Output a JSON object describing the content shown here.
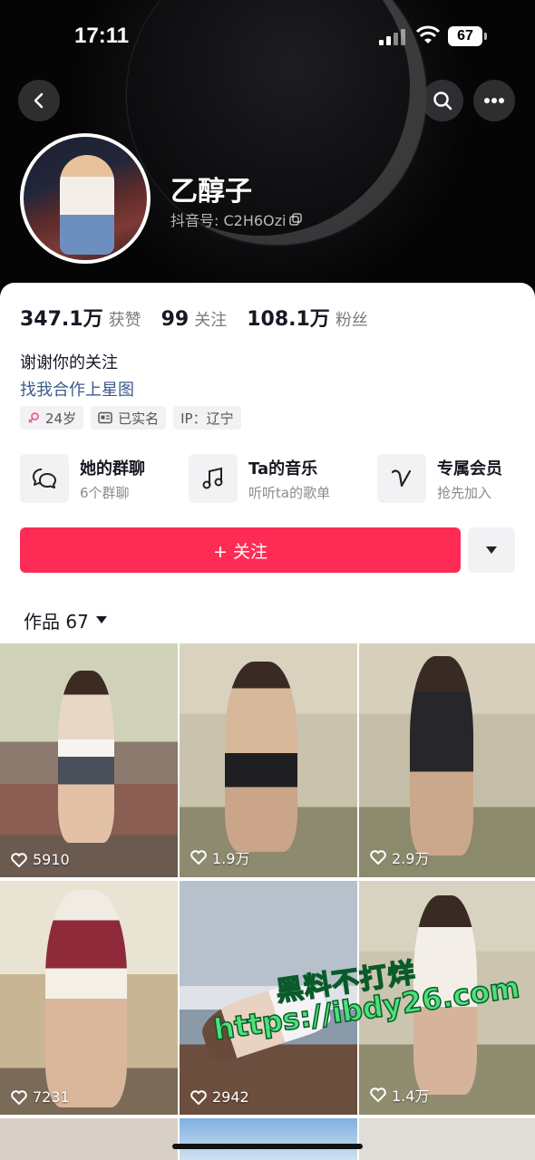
{
  "status_bar": {
    "time": "17:11",
    "battery": "67"
  },
  "profile": {
    "name": "乙醇子",
    "douyin_id": "抖音号: C2H6Ozi",
    "likes_count": "347.1万",
    "likes_label": "获赞",
    "following_count": "99",
    "following_label": "关注",
    "followers_count": "108.1万",
    "followers_label": "粉丝",
    "bio": "谢谢你的关注",
    "link": "找我合作上星图",
    "tags": {
      "age": "24岁",
      "verified": "已实名",
      "ip": "IP：辽宁"
    }
  },
  "features": [
    {
      "title": "她的群聊",
      "sub": "6个群聊",
      "icon": "chat-bubbles-icon"
    },
    {
      "title": "Ta的音乐",
      "sub": "听听ta的歌单",
      "icon": "music-note-icon"
    },
    {
      "title": "专属会员",
      "sub": "抢先加入",
      "icon": "heart-v-icon"
    }
  ],
  "follow_button": "+ 关注",
  "works_tab": "作品 67",
  "videos": [
    {
      "likes": "5910"
    },
    {
      "likes": "1.9万"
    },
    {
      "likes": "2.9万"
    },
    {
      "likes": "7231"
    },
    {
      "likes": "2942"
    },
    {
      "likes": "1.4万"
    }
  ],
  "watermark": {
    "line1": "黑料不打烊",
    "line2": "https://ibdy26.com"
  },
  "colors": {
    "accent": "#fe2c55",
    "link": "#3d5a8c"
  }
}
